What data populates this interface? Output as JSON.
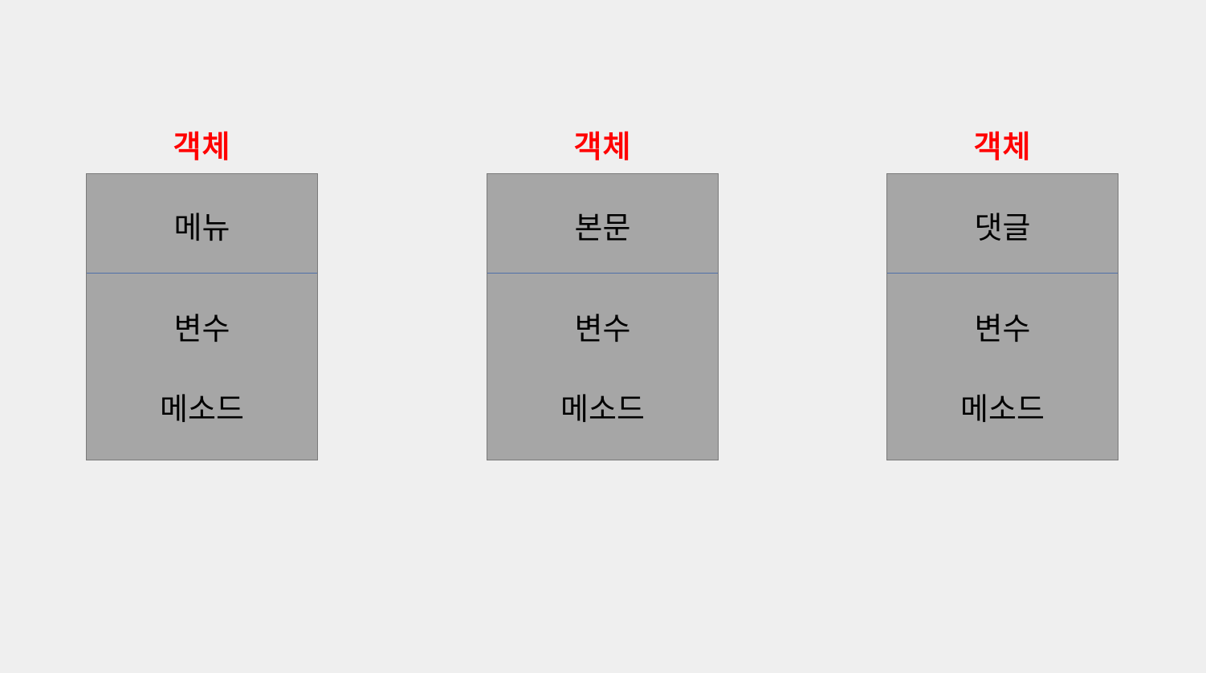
{
  "objects": [
    {
      "title": "객체",
      "name": "메뉴",
      "variable": "변수",
      "method": "메소드"
    },
    {
      "title": "객체",
      "name": "본문",
      "variable": "변수",
      "method": "메소드"
    },
    {
      "title": "객체",
      "name": "댓글",
      "variable": "변수",
      "method": "메소드"
    }
  ],
  "colors": {
    "background": "#efefef",
    "title": "#ff0000",
    "box_fill": "#a6a6a6",
    "box_border": "#7a7a7a",
    "divider": "#4f6fa8",
    "text": "#000000"
  }
}
